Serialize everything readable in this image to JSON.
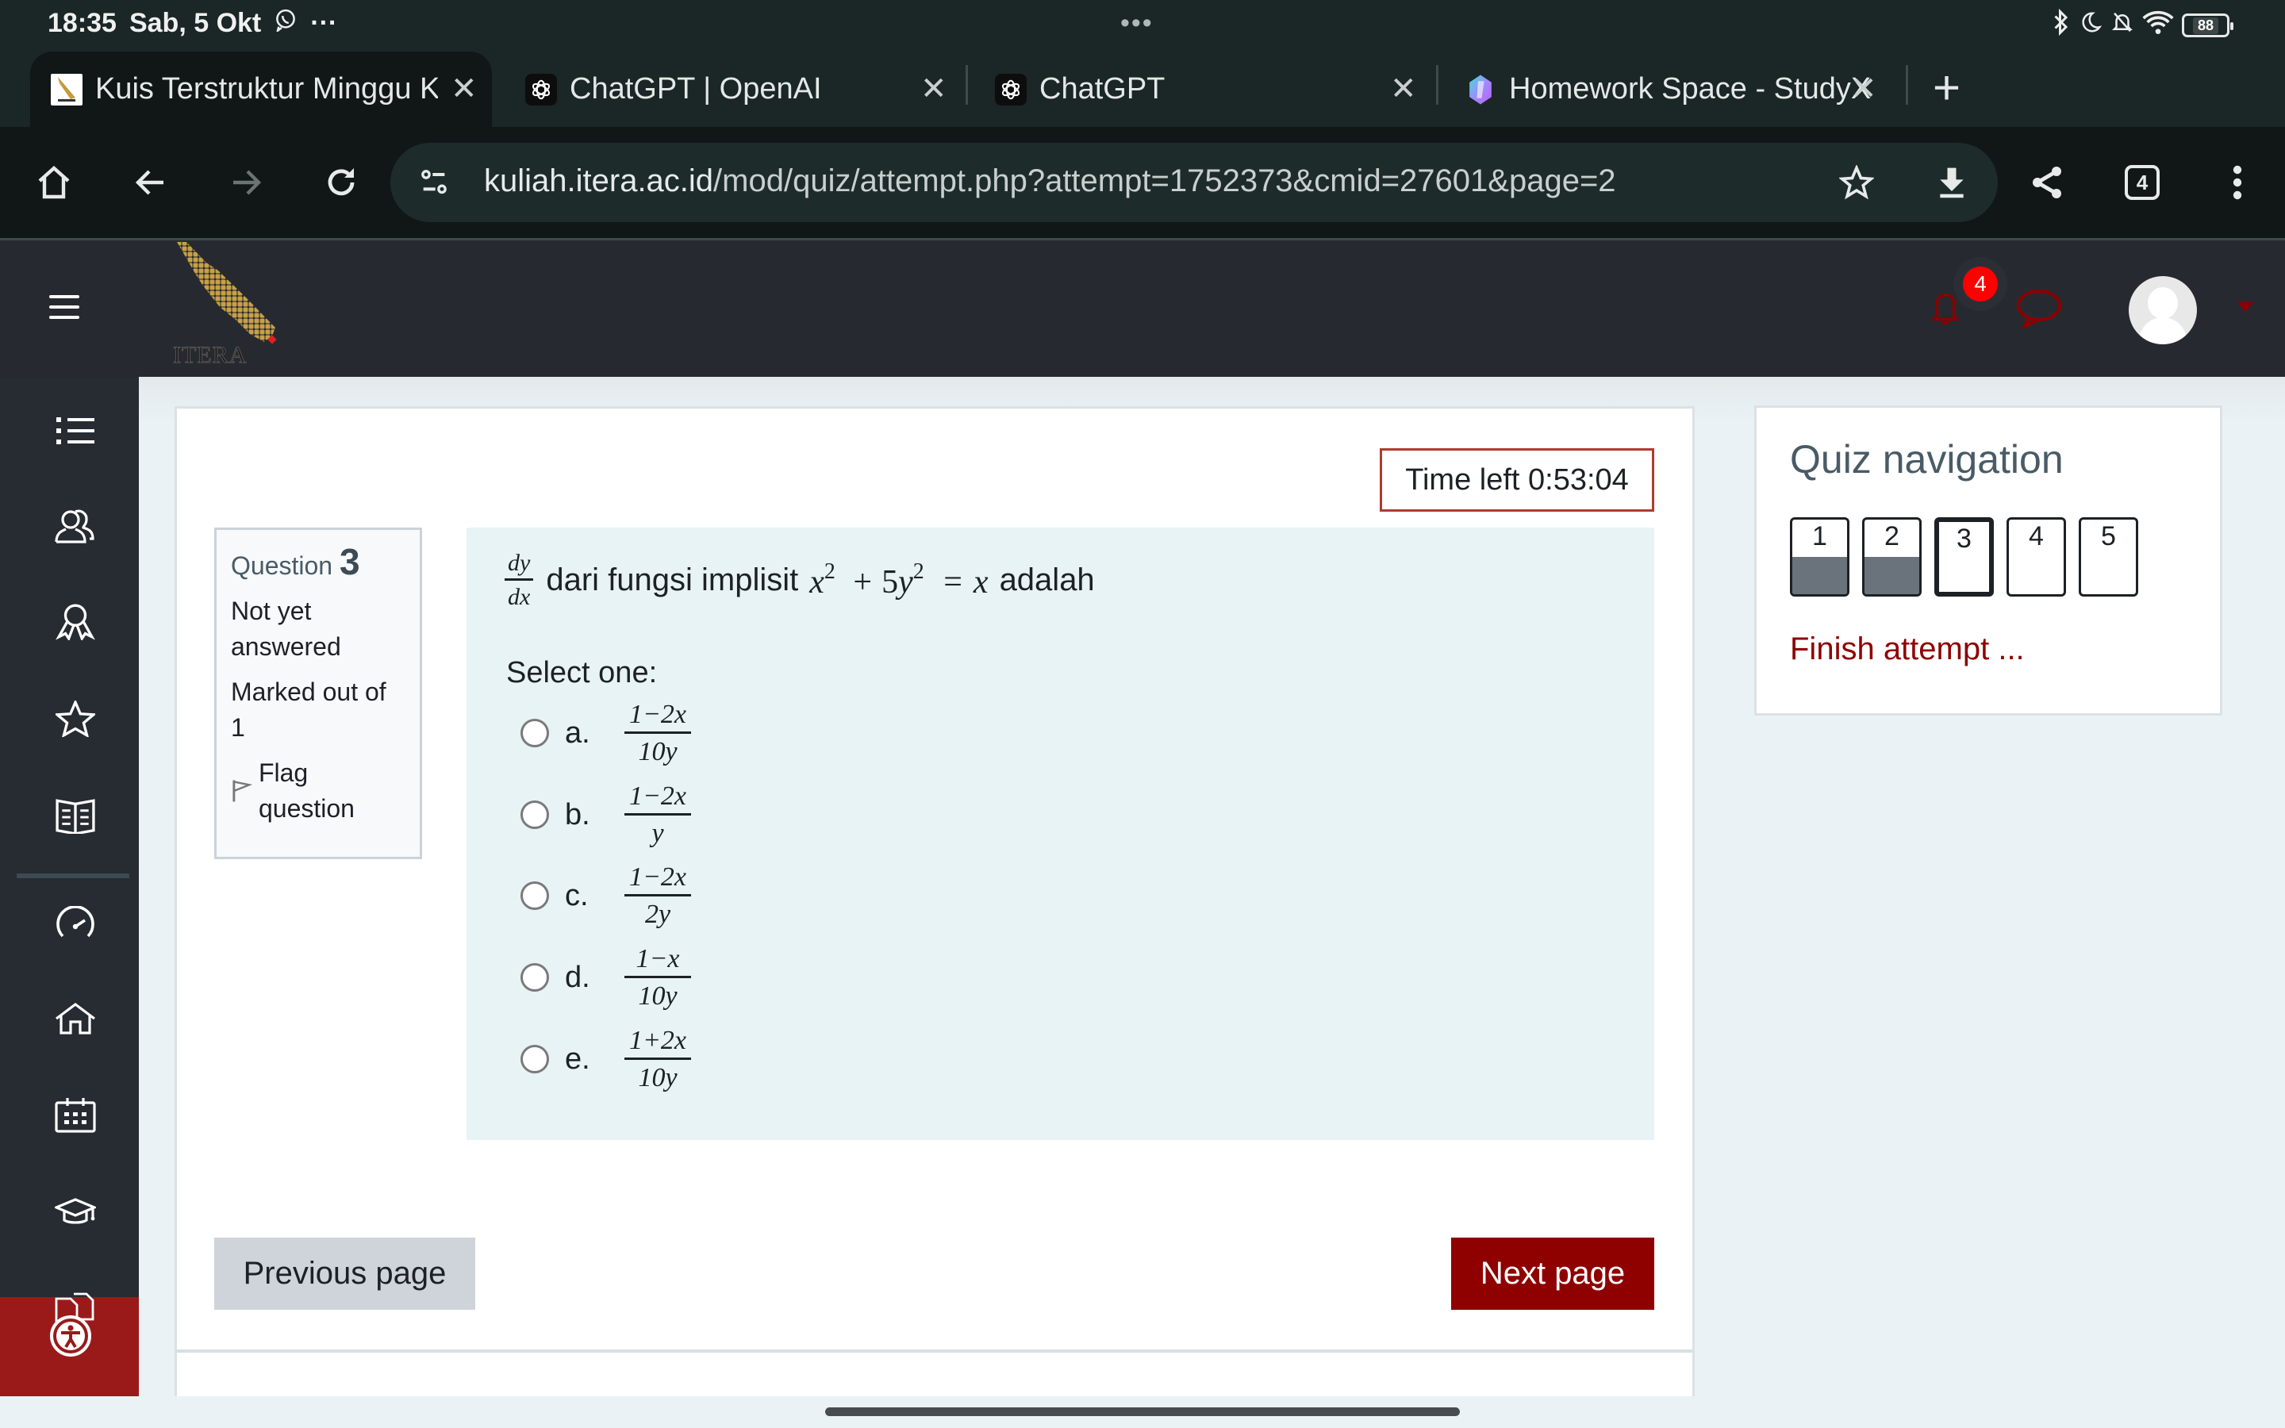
{
  "status_bar": {
    "time": "18:35",
    "date": "Sab, 5 Okt",
    "overflow": "···",
    "center_dots": "•••",
    "battery": "88",
    "icons": [
      "whatsapp-icon",
      "bluetooth-icon",
      "do-not-disturb-icon",
      "notifications-off-icon",
      "wifi-icon",
      "battery-icon"
    ]
  },
  "tabs": [
    {
      "title": "Kuis Terstruktur Minggu Ke-",
      "favicon": "itera-favicon",
      "active": true
    },
    {
      "title": "ChatGPT | OpenAI",
      "favicon": "openai-favicon",
      "active": false
    },
    {
      "title": "ChatGPT",
      "favicon": "openai-favicon",
      "active": false
    },
    {
      "title": "Homework Space - StudyX",
      "favicon": "studyx-favicon",
      "active": false
    }
  ],
  "tab_close": "✕",
  "new_tab": "+",
  "toolbar": {
    "url_host": "kuliah.itera.ac.id",
    "url_path": "/mod/quiz/attempt.php?attempt=1752373&cmid=27601&page=2",
    "tab_count": "4"
  },
  "navbar": {
    "logo_text": "ITERA",
    "notification_count": "4"
  },
  "drawer": {
    "items": [
      "course-index",
      "participants",
      "badges",
      "favourites",
      "grades",
      "dashboard",
      "home",
      "calendar",
      "my-courses",
      "content-bank"
    ]
  },
  "quiz": {
    "timer_label": "Time left 0:53:04",
    "question": {
      "label": "Question",
      "number": "3",
      "status": "Not yet answered",
      "marks": "Marked out of 1",
      "flag_label": "Flag question",
      "text_parts": {
        "deriv_num": "dy",
        "deriv_den": "dx",
        "prefix": "dari fungsi implisit",
        "equation": {
          "x": "x",
          "exp1": "2",
          "plus": "+",
          "coef": "5",
          "y": "y",
          "exp2": "2",
          "eq": "=",
          "rhs": "x"
        },
        "suffix": "adalah"
      },
      "select_label": "Select one:",
      "options": [
        {
          "letter": "a.",
          "num": "1−2x",
          "den": "10y"
        },
        {
          "letter": "b.",
          "num": "1−2x",
          "den": "y"
        },
        {
          "letter": "c.",
          "num": "1−2x",
          "den": "2y"
        },
        {
          "letter": "d.",
          "num": "1−x",
          "den": "10y"
        },
        {
          "letter": "e.",
          "num": "1+2x",
          "den": "10y"
        }
      ]
    },
    "prev_label": "Previous page",
    "next_label": "Next page"
  },
  "quiz_navigation": {
    "title": "Quiz navigation",
    "questions": [
      {
        "n": "1",
        "answered": true,
        "current": false
      },
      {
        "n": "2",
        "answered": true,
        "current": false
      },
      {
        "n": "3",
        "answered": false,
        "current": true
      },
      {
        "n": "4",
        "answered": false,
        "current": false
      },
      {
        "n": "5",
        "answered": false,
        "current": false
      }
    ],
    "finish_label": "Finish attempt ..."
  },
  "colors": {
    "brand": "#8f0000",
    "navbar": "#262a30",
    "question_bg": "#e7f3f5",
    "timer_border": "#b03a2e",
    "answered_fill": "#6a737b"
  }
}
